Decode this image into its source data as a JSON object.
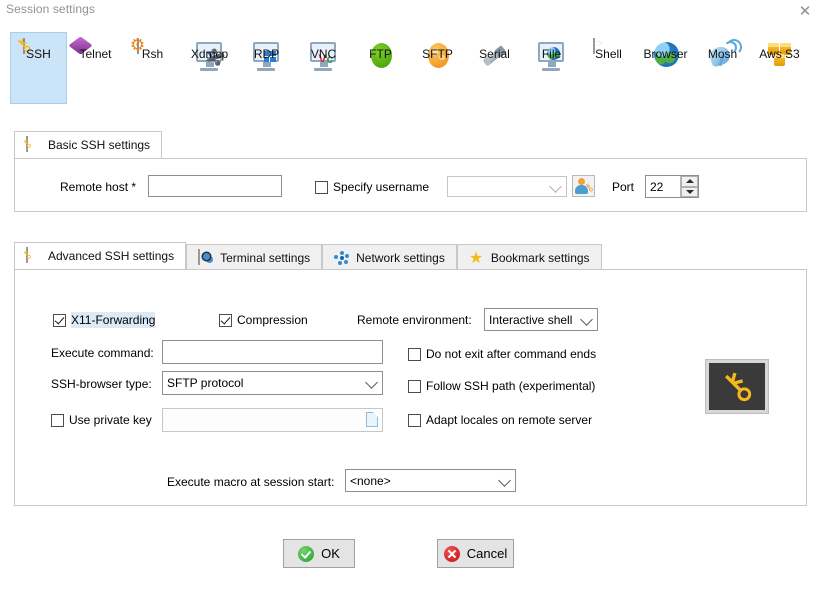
{
  "window": {
    "title": "Session settings",
    "close_label": "✕"
  },
  "protocols": [
    {
      "label": "SSH",
      "icon": "ssh-key-icon",
      "selected": true
    },
    {
      "label": "Telnet",
      "icon": "telnet-diamond-icon",
      "selected": false
    },
    {
      "label": "Rsh",
      "icon": "rsh-gears-icon",
      "selected": false
    },
    {
      "label": "Xdmcp",
      "icon": "xdmcp-monitor-icon",
      "selected": false
    },
    {
      "label": "RDP",
      "icon": "rdp-monitor-icon",
      "selected": false
    },
    {
      "label": "VNC",
      "icon": "vnc-monitor-icon",
      "selected": false
    },
    {
      "label": "FTP",
      "icon": "ftp-green-ball-icon",
      "selected": false
    },
    {
      "label": "SFTP",
      "icon": "sftp-orange-globe-icon",
      "selected": false
    },
    {
      "label": "Serial",
      "icon": "serial-plug-icon",
      "selected": false
    },
    {
      "label": "File",
      "icon": "file-monitor-globe-icon",
      "selected": false
    },
    {
      "label": "Shell",
      "icon": "shell-terminal-icon",
      "selected": false
    },
    {
      "label": "Browser",
      "icon": "browser-globe-icon",
      "selected": false
    },
    {
      "label": "Mosh",
      "icon": "mosh-satellite-icon",
      "selected": false
    },
    {
      "label": "Aws S3",
      "icon": "aws-s3-cubes-icon",
      "selected": false
    }
  ],
  "basic": {
    "tab_label": "Basic SSH settings",
    "tab_icon": "ssh-key-icon",
    "remote_host_label": "Remote host *",
    "remote_host_value": "",
    "specify_username_label": "Specify username",
    "specify_username_checked": false,
    "username_value": "",
    "username_button_icon": "user-key-icon",
    "port_label": "Port",
    "port_value": "22"
  },
  "advanced_tabs": [
    {
      "label": "Advanced SSH settings",
      "icon": "ssh-key-icon",
      "active": true
    },
    {
      "label": "Terminal settings",
      "icon": "terminal-gear-icon",
      "active": false
    },
    {
      "label": "Network settings",
      "icon": "network-dots-icon",
      "active": false
    },
    {
      "label": "Bookmark settings",
      "icon": "star-icon",
      "active": false
    }
  ],
  "advanced": {
    "x11_label": "X11-Forwarding",
    "x11_checked": true,
    "compression_label": "Compression",
    "compression_checked": true,
    "remote_env_label": "Remote environment:",
    "remote_env_value": "Interactive shell",
    "execute_command_label": "Execute command:",
    "execute_command_value": "",
    "ssh_browser_label": "SSH-browser type:",
    "ssh_browser_value": "SFTP protocol",
    "use_private_key_label": "Use private key",
    "use_private_key_checked": false,
    "private_key_value": "",
    "private_key_browse_icon": "file-browse-icon",
    "do_not_exit_label": "Do not exit after command ends",
    "do_not_exit_checked": false,
    "follow_ssh_path_label": "Follow SSH path (experimental)",
    "follow_ssh_path_checked": false,
    "adapt_locales_label": "Adapt locales on remote server",
    "adapt_locales_checked": false,
    "key_image_icon": "big-key-icon",
    "macro_label": "Execute macro at session start:",
    "macro_value": "<none>"
  },
  "footer": {
    "ok_label": "OK",
    "ok_icon": "green-check-icon",
    "cancel_label": "Cancel",
    "cancel_icon": "red-x-icon"
  }
}
